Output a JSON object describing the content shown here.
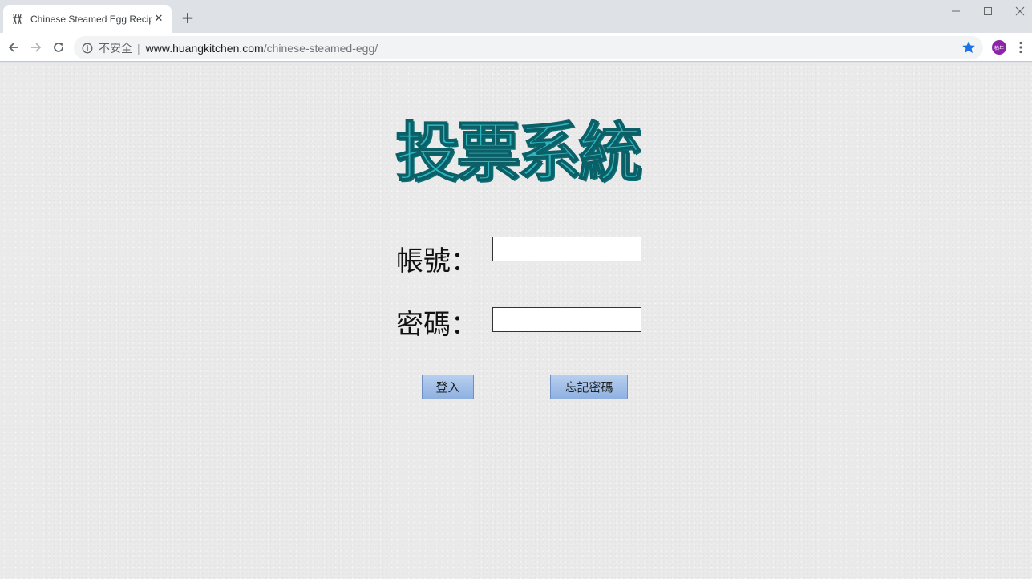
{
  "browser": {
    "tab": {
      "title": "Chinese Steamed Egg Recipe 蒸",
      "close_glyph": "✕",
      "favicon": "chopsticks-favicon-icon"
    },
    "new_tab_glyph": "+",
    "window_controls": {
      "minimize": "minimize-icon",
      "maximize": "maximize-icon",
      "close": "close-icon"
    },
    "address_bar": {
      "security_label": "不安全",
      "separator": "|",
      "url_host": "www.huangkitchen.com",
      "url_path": "/chinese-steamed-egg/"
    },
    "profile_avatar_text": "柏年",
    "colors": {
      "bookmark_star": "#1a73e8",
      "avatar": "#8e24aa"
    }
  },
  "page": {
    "title": "投票系統",
    "account_label": "帳號：",
    "account_value": "",
    "password_label": "密碼：",
    "password_value": "",
    "login_button": "登入",
    "forgot_password_button": "忘記密碼",
    "colors": {
      "title_fill": "#2fb4bd",
      "title_outline": "#0b5f66",
      "button": "#9fbde8"
    }
  }
}
